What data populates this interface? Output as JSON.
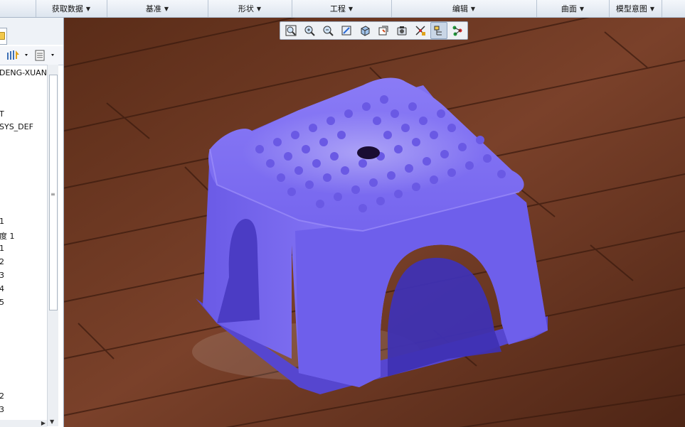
{
  "ribbon": {
    "groups": [
      {
        "label": "获取数据"
      },
      {
        "label": "基准"
      },
      {
        "label": "形状"
      },
      {
        "label": "工程"
      },
      {
        "label": "编辑"
      },
      {
        "label": "曲面"
      },
      {
        "label": "模型意图"
      }
    ]
  },
  "model_tree": {
    "items": [
      "DENG-XUAN",
      "T",
      "SYS_DEF",
      "1",
      "度 1",
      "1",
      "2",
      "3",
      "4",
      "5",
      "2",
      "3"
    ]
  },
  "view_toolbar": {
    "buttons": [
      {
        "icon": "refit-icon"
      },
      {
        "icon": "zoom-in-icon"
      },
      {
        "icon": "zoom-out-icon"
      },
      {
        "icon": "repaint-icon"
      },
      {
        "icon": "display-style-icon"
      },
      {
        "icon": "saved-views-icon"
      },
      {
        "icon": "view-manager-icon"
      },
      {
        "icon": "datum-display-icon"
      },
      {
        "icon": "spin-center-icon"
      },
      {
        "icon": "annotation-display-icon"
      }
    ]
  },
  "colors": {
    "stool": "#7c6cf2",
    "floor": "#6f3a22"
  }
}
